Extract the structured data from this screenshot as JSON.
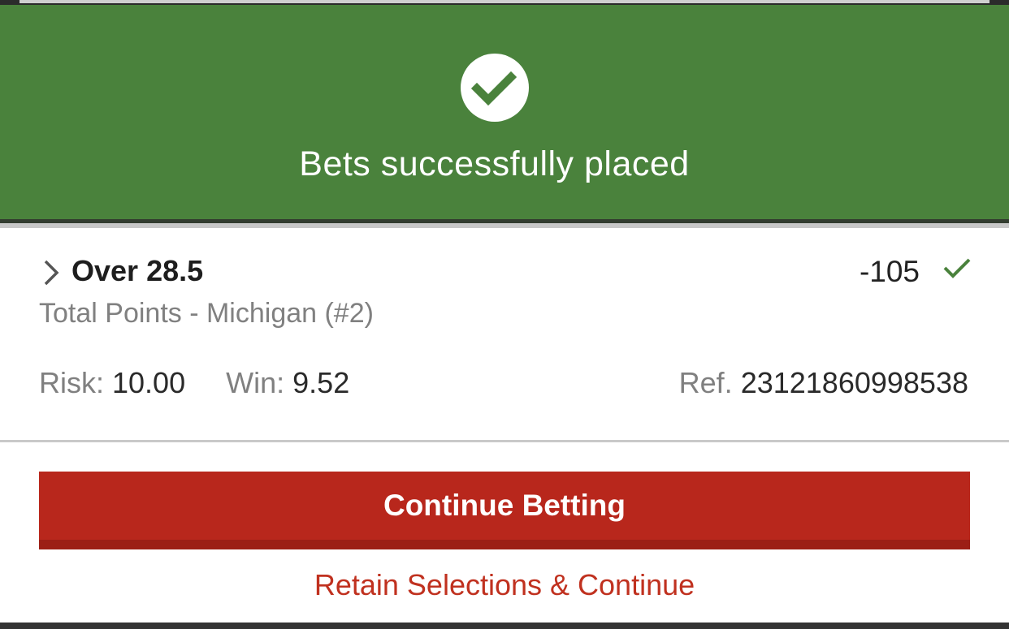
{
  "banner": {
    "title": "Bets successfully placed",
    "icon": "check-circle-icon",
    "color": "#4a823c"
  },
  "bet": {
    "selection": "Over",
    "line": "28.5",
    "odds": "-105",
    "market": "Total Points - Michigan (#2)",
    "risk_label": "Risk:",
    "risk_value": "10.00",
    "win_label": "Win:",
    "win_value": "9.52",
    "ref_label": "Ref.",
    "ref_value": "23121860998538",
    "status_icon": "check-icon",
    "expand_icon": "chevron-right-icon"
  },
  "actions": {
    "continue_label": "Continue Betting",
    "retain_label": "Retain Selections & Continue",
    "accent_color": "#b8271c"
  }
}
